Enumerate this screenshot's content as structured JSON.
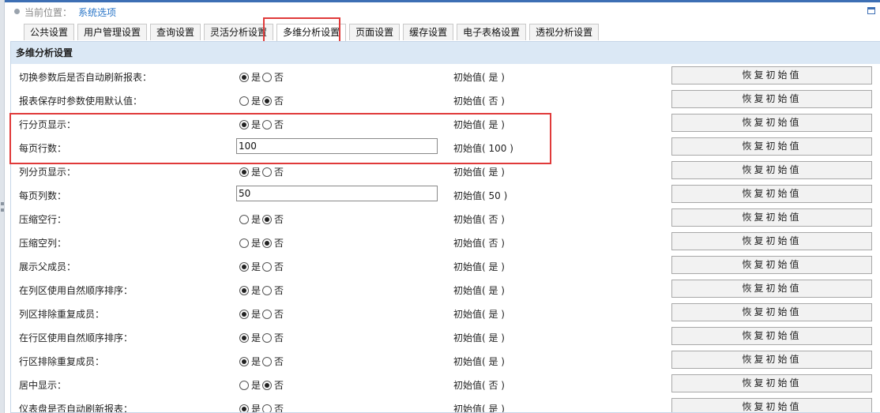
{
  "breadcrumb": {
    "label": "当前位置：",
    "current": "系统选项"
  },
  "tabs": [
    {
      "label": "公共设置"
    },
    {
      "label": "用户管理设置"
    },
    {
      "label": "查询设置"
    },
    {
      "label": "灵活分析设置"
    },
    {
      "label": "多维分析设置",
      "active": true
    },
    {
      "label": "页面设置"
    },
    {
      "label": "缓存设置"
    },
    {
      "label": "电子表格设置"
    },
    {
      "label": "透视分析设置"
    }
  ],
  "section": {
    "title": "多维分析设置"
  },
  "rows": [
    {
      "label": "切换参数后是否自动刷新报表：",
      "type": "radio",
      "selected": "yes",
      "yes": "是",
      "no": "否",
      "initial": "初始值( 是 )",
      "button": "恢复初始值"
    },
    {
      "label": "报表保存时参数使用默认值：",
      "type": "radio",
      "selected": "no",
      "yes": "是",
      "no": "否",
      "initial": "初始值( 否 )",
      "button": "恢复初始值"
    },
    {
      "label": "行分页显示：",
      "type": "radio",
      "selected": "yes",
      "yes": "是",
      "no": "否",
      "initial": "初始值( 是 )",
      "button": "恢复初始值"
    },
    {
      "label": "每页行数：",
      "type": "input",
      "value": "100",
      "initial": "初始值( 100 )",
      "button": "恢复初始值"
    },
    {
      "label": "列分页显示：",
      "type": "radio",
      "selected": "yes",
      "yes": "是",
      "no": "否",
      "initial": "初始值( 是 )",
      "button": "恢复初始值"
    },
    {
      "label": "每页列数：",
      "type": "input",
      "value": "50",
      "initial": "初始值( 50 )",
      "button": "恢复初始值"
    },
    {
      "label": "压缩空行：",
      "type": "radio",
      "selected": "no",
      "yes": "是",
      "no": "否",
      "initial": "初始值( 否 )",
      "button": "恢复初始值"
    },
    {
      "label": "压缩空列：",
      "type": "radio",
      "selected": "no",
      "yes": "是",
      "no": "否",
      "initial": "初始值( 否 )",
      "button": "恢复初始值"
    },
    {
      "label": "展示父成员：",
      "type": "radio",
      "selected": "yes",
      "yes": "是",
      "no": "否",
      "initial": "初始值( 是 )",
      "button": "恢复初始值"
    },
    {
      "label": "在列区使用自然顺序排序：",
      "type": "radio",
      "selected": "yes",
      "yes": "是",
      "no": "否",
      "initial": "初始值( 是 )",
      "button": "恢复初始值"
    },
    {
      "label": "列区排除重复成员：",
      "type": "radio",
      "selected": "yes",
      "yes": "是",
      "no": "否",
      "initial": "初始值( 是 )",
      "button": "恢复初始值"
    },
    {
      "label": "在行区使用自然顺序排序：",
      "type": "radio",
      "selected": "yes",
      "yes": "是",
      "no": "否",
      "initial": "初始值( 是 )",
      "button": "恢复初始值"
    },
    {
      "label": "行区排除重复成员：",
      "type": "radio",
      "selected": "yes",
      "yes": "是",
      "no": "否",
      "initial": "初始值( 是 )",
      "button": "恢复初始值"
    },
    {
      "label": "居中显示：",
      "type": "radio",
      "selected": "no",
      "yes": "是",
      "no": "否",
      "initial": "初始值( 否 )",
      "button": "恢复初始值"
    },
    {
      "label": "仪表盘是否自动刷新报表：",
      "type": "radio",
      "selected": "yes",
      "yes": "是",
      "no": "否",
      "initial": "初始值( 是 )",
      "button": "恢复初始值"
    }
  ],
  "colors": {
    "accent": "#3d6fb4",
    "link": "#2a76c8",
    "header_bg": "#dbe8f5",
    "highlight": "#e03a3a"
  }
}
